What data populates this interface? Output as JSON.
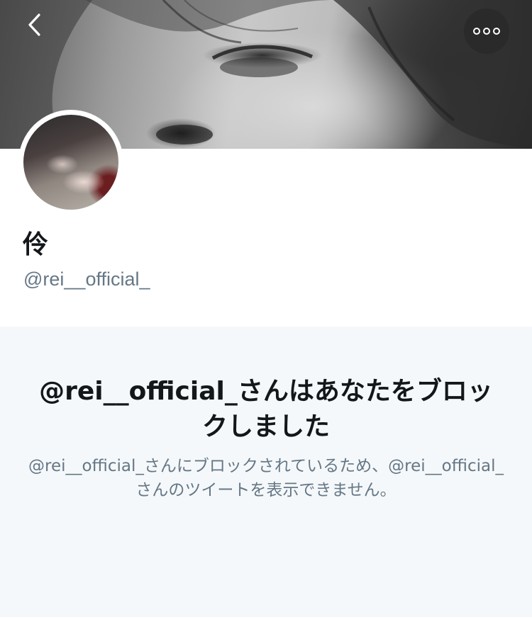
{
  "header": {
    "back_icon": "chevron-left-icon",
    "more_icon": "more-horizontal-icon"
  },
  "profile": {
    "display_name": "伶",
    "handle": "@rei__official_"
  },
  "blocked": {
    "title": "@rei__official_さんはあなたをブロックしました",
    "description": "@rei__official_さんにブロックされているため、@rei__official_さんのツイートを表示できません。"
  },
  "colors": {
    "primary_text": "#14171a",
    "secondary_text": "#657786",
    "background": "#f5f8fa",
    "surface": "#ffffff"
  }
}
